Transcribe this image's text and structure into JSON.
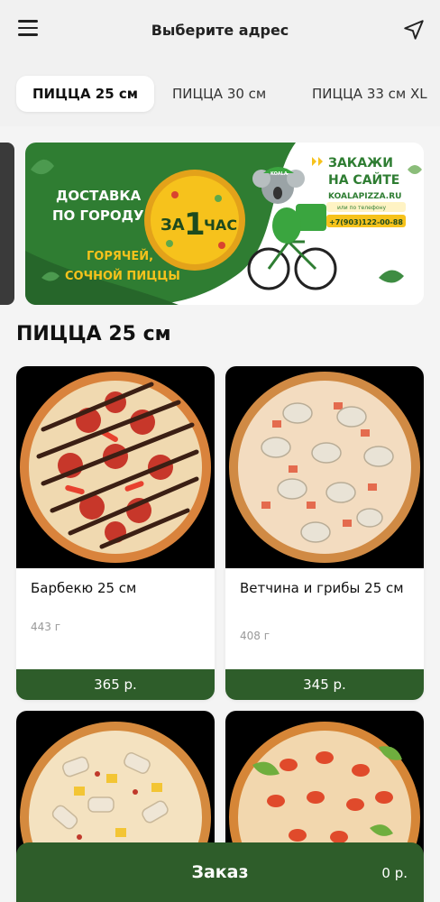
{
  "header": {
    "title": "Выберите адрес",
    "menu_icon": "hamburger-menu-icon",
    "location_icon": "navigation-arrow-icon"
  },
  "tabs": [
    {
      "label": "ПИЦЦА 25 см",
      "active": true
    },
    {
      "label": "ПИЦЦА 30 см",
      "active": false
    },
    {
      "label": "ПИЦЦА 33 см XL",
      "active": false
    }
  ],
  "banner": {
    "left_line1": "ДОСТАВКА",
    "left_line2": "ПО ГОРОДУ",
    "slogan_line1": "ГОРЯЧЕЙ,",
    "slogan_line2": "СОЧНОЙ ПИЦЦЫ",
    "badge_pre": "ЗА",
    "badge_num": "1",
    "badge_post": "ЧАС",
    "cta_line1": "ЗАКАЖИ",
    "cta_line2": "НА САЙТЕ",
    "site": "KOALAPIZZA.RU",
    "phone_note": "или по телефону",
    "phone": "+7(903)122-00-88",
    "mascot_cap": "KOALA"
  },
  "section": {
    "title": "ПИЦЦА 25 см"
  },
  "products": [
    {
      "name": "Барбекю 25 см",
      "weight": "443 г",
      "price": "365 р."
    },
    {
      "name": "Ветчина и грибы 25 см",
      "weight": "408 г",
      "price": "345 р."
    }
  ],
  "order": {
    "label": "Заказ",
    "total": "0 р."
  },
  "colors": {
    "accent": "#2e5d2a",
    "banner_green": "#2f7d32",
    "badge_yellow": "#f6c21c"
  }
}
